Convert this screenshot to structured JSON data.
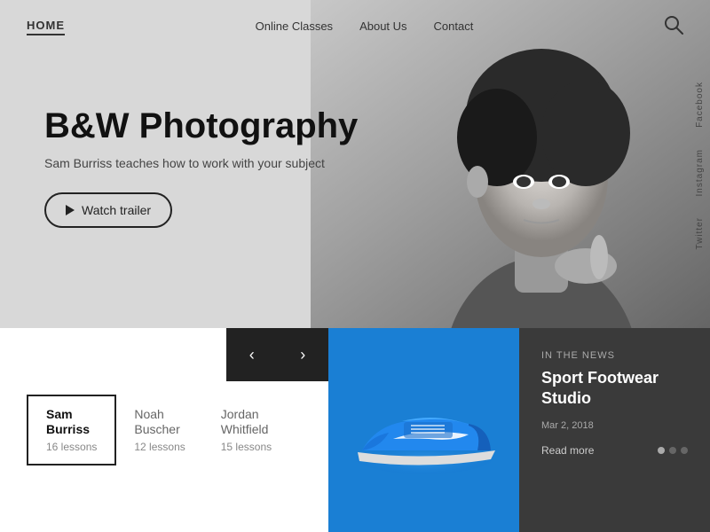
{
  "header": {
    "logo": "HOME",
    "nav": [
      {
        "label": "Online Classes",
        "active": false
      },
      {
        "label": "About Us",
        "active": false
      },
      {
        "label": "Contact",
        "active": false
      }
    ]
  },
  "hero": {
    "title": "B&W Photography",
    "subtitle": "Sam Burriss teaches how to work with your subject",
    "cta_label": "Watch trailer"
  },
  "social": [
    {
      "label": "Facebook"
    },
    {
      "label": "Instagram"
    },
    {
      "label": "Twitter"
    }
  ],
  "instructors": [
    {
      "name": "Sam\nBurriss",
      "lessons": "16 lessons",
      "active": true
    },
    {
      "name": "Noah\nBuscher",
      "lessons": "12 lessons",
      "active": false
    },
    {
      "name": "Jordan\nWhitfield",
      "lessons": "15 lessons",
      "active": false
    }
  ],
  "news": {
    "label": "In The News",
    "title": "Sport Footwear Studio",
    "date": "Mar 2, 2018",
    "read_more": "Read more"
  }
}
